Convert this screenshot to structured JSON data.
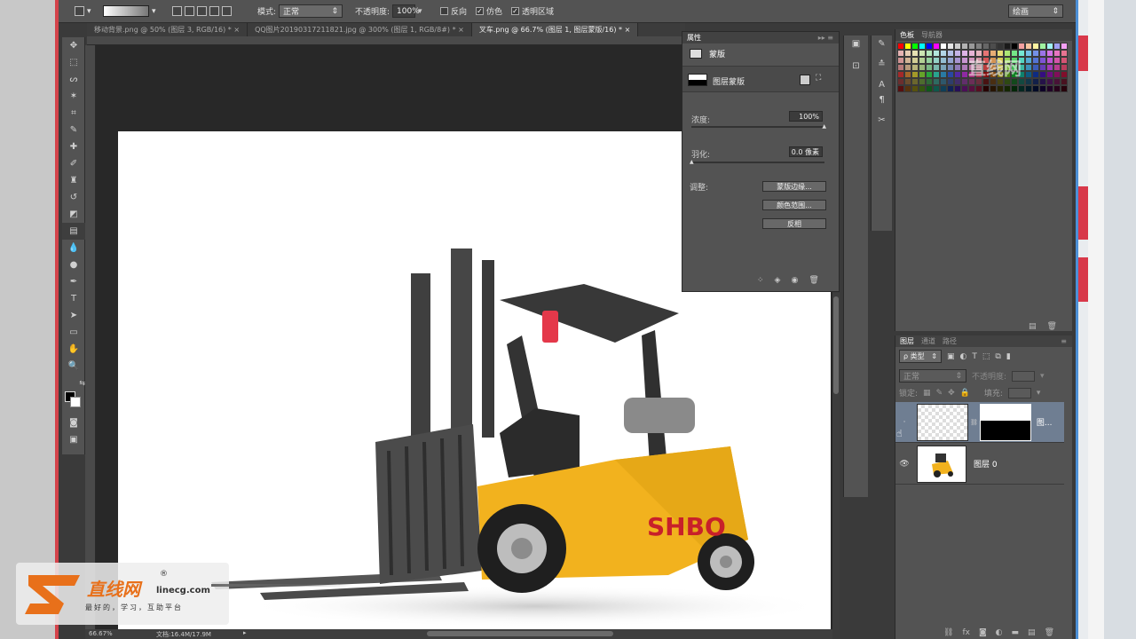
{
  "options": {
    "mode_label": "模式:",
    "mode_value": "正常",
    "opacity_label": "不透明度:",
    "opacity_value": "100%",
    "reverse": "反向",
    "dither": "仿色",
    "transparency": "透明区域",
    "workspace": "绘画"
  },
  "tabs": [
    "移动背景.png @ 50% (图层 3, RGB/16) *",
    "QQ图片20190317211821.jpg @ 300% (图层 1, RGB/8#) *",
    "叉车.png @ 66.7% (图层 1, 图层蒙版/16) *"
  ],
  "properties": {
    "tab": "属性",
    "mask_title": "蒙版",
    "layer_mask": "图层蒙版",
    "density_label": "浓度:",
    "density_value": "100%",
    "feather_label": "羽化:",
    "feather_value": "0.0 像素",
    "adjust_label": "调整:",
    "btn_edge": "蒙版边缘...",
    "btn_color": "颜色范围...",
    "btn_invert": "反相"
  },
  "swatches": {
    "tab_swatch": "色板",
    "tab_nav": "导航器"
  },
  "layers": {
    "tab_layers": "图层",
    "tab_channels": "通道",
    "tab_paths": "路径",
    "filter": "ρ 类型",
    "blend": "正常",
    "opacity_label": "不透明度:",
    "lock_label": "锁定:",
    "fill_label": "填充:",
    "layer1": "图...",
    "layer0": "图层 0"
  },
  "status": {
    "zoom": "66.67%",
    "doc": "文档:16.4M/17.9M"
  },
  "canvas": {
    "brand": "SHBO"
  },
  "watermark": {
    "brand": "直线网",
    "reg": "®",
    "url": "linecg.com",
    "slogan": "最好的，学习，互助平台",
    "tr_brand": "直线网"
  },
  "colors": {
    "accent": "#4c8fd6",
    "panel": "#535353",
    "forklift": "#f2b21e",
    "red_frame": "#d4424a"
  }
}
